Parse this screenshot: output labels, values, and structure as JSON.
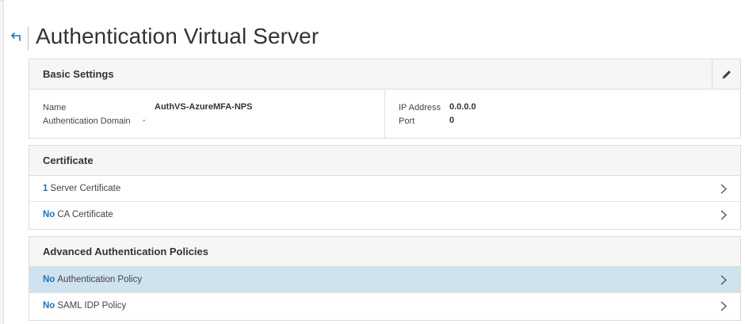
{
  "page": {
    "title": "Authentication Virtual Server"
  },
  "basic_settings": {
    "header": "Basic Settings",
    "name_label": "Name",
    "name_value": "AuthVS-AzureMFA-NPS",
    "auth_domain_label": "Authentication Domain",
    "auth_domain_value": "-",
    "ip_label": "IP Address",
    "ip_value": "0.0.0.0",
    "port_label": "Port",
    "port_value": "0"
  },
  "certificate": {
    "header": "Certificate",
    "rows": [
      {
        "count": "1",
        "label": "Server Certificate"
      },
      {
        "count": "No",
        "label": "CA Certificate"
      }
    ]
  },
  "advanced_policies": {
    "header": "Advanced Authentication Policies",
    "rows": [
      {
        "count": "No",
        "label": "Authentication Policy",
        "selected": true
      },
      {
        "count": "No",
        "label": "SAML IDP Policy"
      }
    ]
  },
  "icons": {
    "back": "back-arrow-icon",
    "edit": "pencil-icon",
    "chevron": "chevron-right-icon"
  },
  "colors": {
    "accent": "#1b75bb",
    "selected_row": "#cfe3ef",
    "header_bg": "#f6f6f6"
  }
}
